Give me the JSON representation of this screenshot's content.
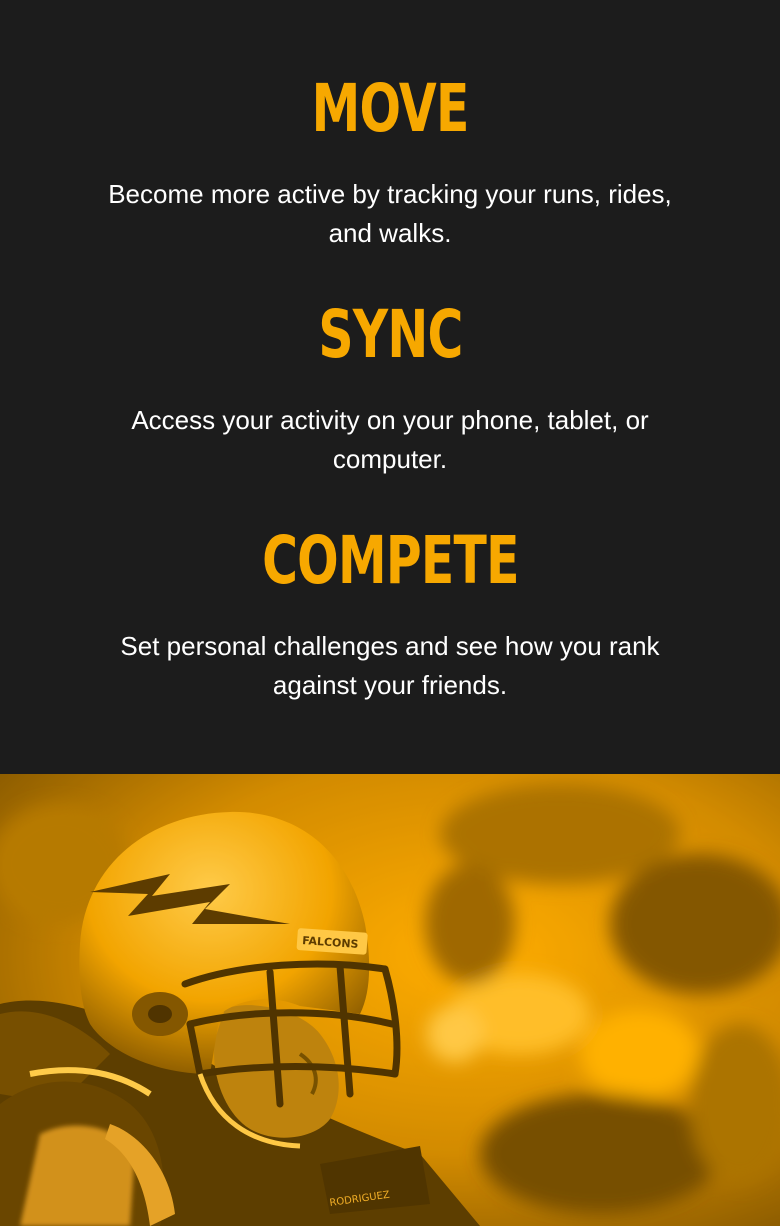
{
  "features": [
    {
      "title": "MOVE",
      "description": "Become more active by tracking your runs, rides, and walks."
    },
    {
      "title": "SYNC",
      "description": "Access your activity on your phone, tablet, or computer."
    },
    {
      "title": "COMPETE",
      "description": "Set personal challenges and see how you rank against your friends."
    }
  ],
  "hero": {
    "image": "football-player-photo",
    "helmet_text": "FALCONS",
    "jersey_text": "RODRIGUEZ"
  },
  "colors": {
    "background": "#1c1c1c",
    "accent": "#f7a800",
    "text": "#ffffff",
    "photo_tint": "#ffad00"
  }
}
